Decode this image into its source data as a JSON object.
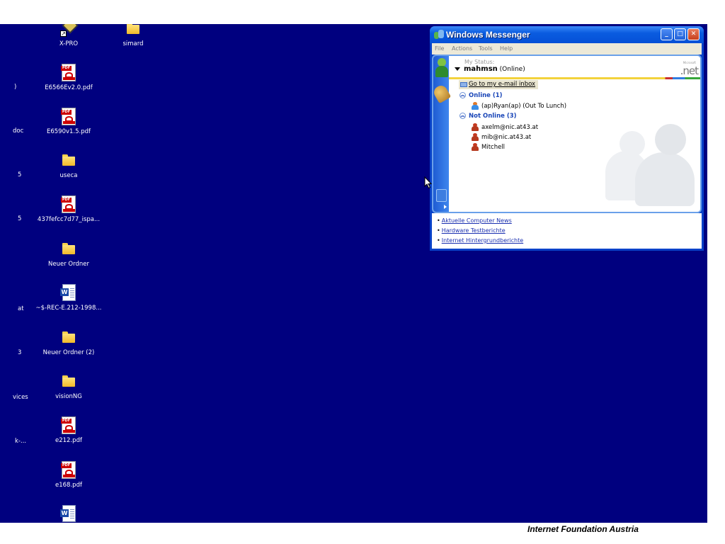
{
  "desktop": {
    "left_fragments": [
      {
        "text": ")",
        "top": "E6566Ev2.0.pdf"
      },
      {
        "text": "doc"
      },
      {
        "text": "5"
      },
      {
        "text": "5"
      },
      {
        "text": "at"
      },
      {
        "text": "3"
      },
      {
        "text": "vices"
      },
      {
        "text": "k-..."
      }
    ],
    "icons": [
      {
        "label": "X-PRO",
        "type": "shortcut"
      },
      {
        "label": "simard",
        "type": "folder"
      },
      {
        "label": "E6566Ev2.0.pdf",
        "type": "pdf"
      },
      {
        "label": "E6590v1.5.pdf",
        "type": "pdf"
      },
      {
        "label": "useca",
        "type": "folder"
      },
      {
        "label": "437fefcc7d77_ispa...",
        "type": "pdf"
      },
      {
        "label": "Neuer Ordner",
        "type": "folder"
      },
      {
        "label": "~$-REC-E.212-1998...",
        "type": "word"
      },
      {
        "label": "Neuer Ordner (2)",
        "type": "folder"
      },
      {
        "label": "visionNG",
        "type": "folder"
      },
      {
        "label": "e212.pdf",
        "type": "pdf"
      },
      {
        "label": "e168.pdf",
        "type": "pdf"
      },
      {
        "label": "",
        "type": "word"
      }
    ],
    "pdf_badge": "PDF",
    "word_badge": "W",
    "colors": {
      "background": "#00007f",
      "label": "#ffffff"
    }
  },
  "messenger": {
    "title": "Windows Messenger",
    "window_buttons": {
      "minimize": "_",
      "maximize": "□",
      "close": "✕"
    },
    "menu": [
      "File",
      "Actions",
      "Tools",
      "Help"
    ],
    "status_label": "My Status:",
    "username": "mahmsn",
    "status": "(Online)",
    "brand": ".net",
    "brand_small": "Microsoft",
    "inbox_link": "Go to my e-mail inbox",
    "groups": {
      "online": {
        "title": "Online (1)",
        "contacts": [
          "(ap)Ryan(ap) (Out To Lunch)"
        ]
      },
      "offline": {
        "title": "Not Online (3)",
        "contacts": [
          "axelm@nic.at43.at",
          "mib@nic.at43.at",
          "Mitchell"
        ]
      }
    },
    "news_links": [
      "Aktuelle Computer News",
      "Hardware Testberichte",
      "Internet Hintergrundberichte"
    ],
    "colors": {
      "titlebar": "#0a5ce0",
      "group_text": "#1a46b8",
      "link": "#1a2fb0"
    }
  },
  "footer": {
    "text": "Internet Foundation Austria"
  }
}
